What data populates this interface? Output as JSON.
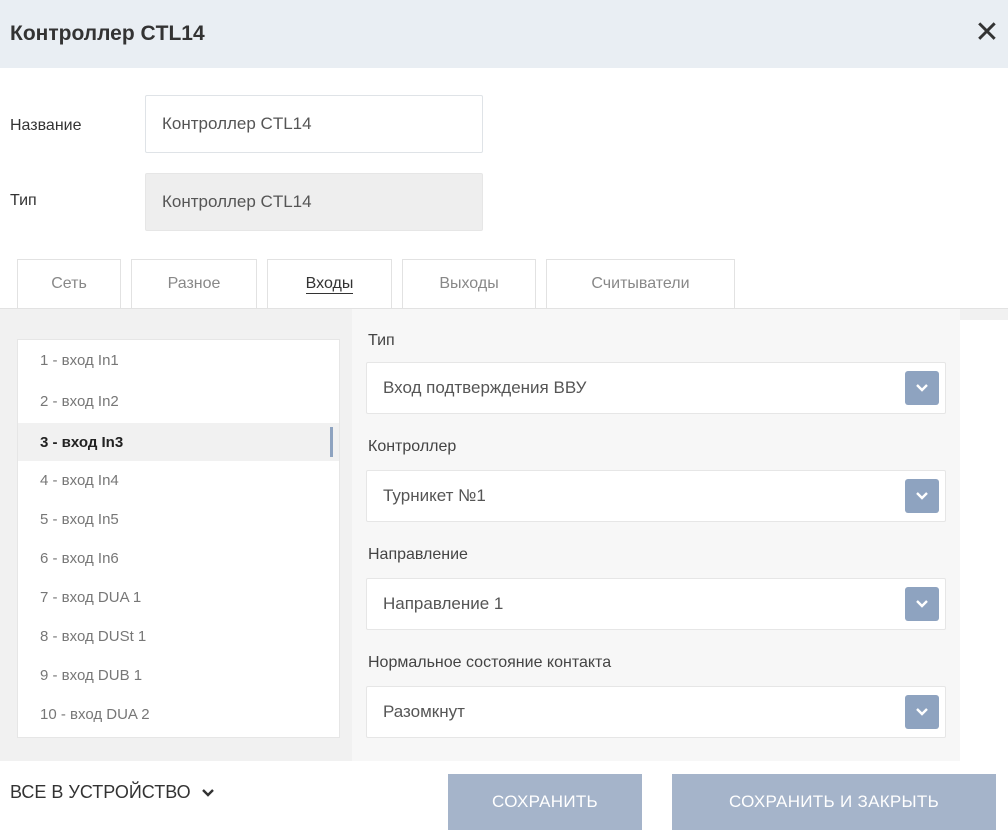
{
  "window": {
    "title": "Контроллер CTL14",
    "close_icon": "close-icon"
  },
  "fields": {
    "name_label": "Название",
    "name_value": "Контроллер CTL14",
    "type_label": "Тип",
    "type_value": "Контроллер CTL14"
  },
  "tabs": [
    {
      "label": "Сеть",
      "active": false
    },
    {
      "label": "Разное",
      "active": false
    },
    {
      "label": "Входы",
      "active": true
    },
    {
      "label": "Выходы",
      "active": false
    },
    {
      "label": "Считыватели",
      "active": false
    }
  ],
  "inputs_list": [
    {
      "label": "1 - вход In1",
      "selected": false
    },
    {
      "label": "2 - вход In2",
      "selected": false
    },
    {
      "label": "3 - вход In3",
      "selected": true
    },
    {
      "label": "4 - вход In4",
      "selected": false
    },
    {
      "label": "5 - вход In5",
      "selected": false
    },
    {
      "label": "6 - вход In6",
      "selected": false
    },
    {
      "label": "7 - вход DUA 1",
      "selected": false
    },
    {
      "label": "8 - вход DUSt 1",
      "selected": false
    },
    {
      "label": "9 - вход DUB 1",
      "selected": false
    },
    {
      "label": "10 - вход DUA 2",
      "selected": false
    }
  ],
  "settings": {
    "type_label": "Тип",
    "type_value": "Вход подтверждения ВВУ",
    "controller_label": "Контроллер",
    "controller_value": "Турникет №1",
    "direction_label": "Направление",
    "direction_value": "Направление 1",
    "contact_label": "Нормальное состояние контакта",
    "contact_value": "Разомкнут"
  },
  "footer": {
    "all_to_device": "ВСЕ В УСТРОЙСТВО",
    "save": "СОХРАНИТЬ",
    "save_close": "СОХРАНИТЬ И ЗАКРЫТЬ"
  },
  "colors": {
    "accent": "#8ea3c0",
    "button": "#a5b4ca",
    "titlebar": "#e9eef3"
  }
}
